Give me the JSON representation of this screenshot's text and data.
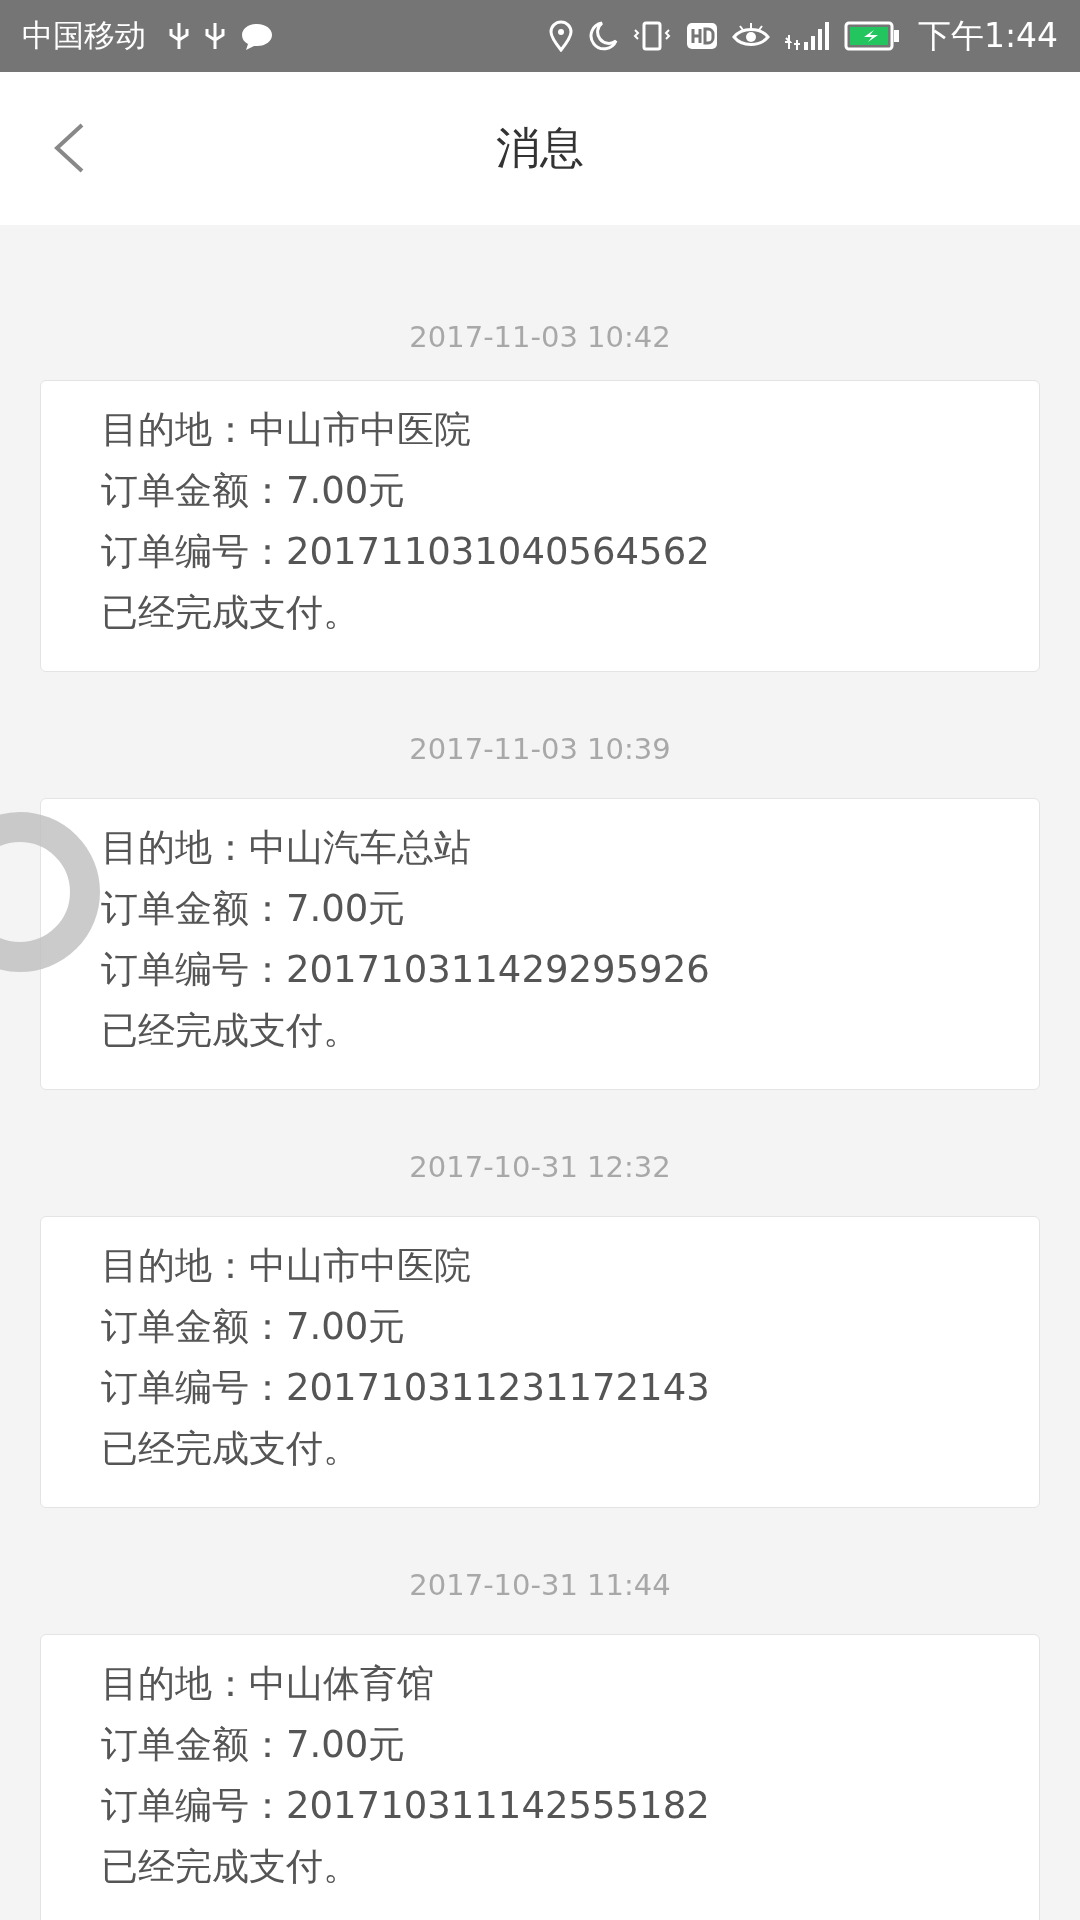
{
  "status_bar": {
    "carrier": "中国移动",
    "time": "下午1:44"
  },
  "header": {
    "title": "消息"
  },
  "messages": [
    {
      "time": "2017-11-03 10:42",
      "lines": [
        "目的地：中山市中医院",
        "订单金额：7.00元",
        "订单编号：201711031040564562",
        "已经完成支付。"
      ]
    },
    {
      "time": "2017-11-03 10:39",
      "lines": [
        "目的地：中山汽车总站",
        "订单金额：7.00元",
        "订单编号：201710311429295926",
        "已经完成支付。"
      ]
    },
    {
      "time": "2017-10-31 12:32",
      "lines": [
        "目的地：中山市中医院",
        "订单金额：7.00元",
        "订单编号：201710311231172143",
        "已经完成支付。"
      ]
    },
    {
      "time": "2017-10-31 11:44",
      "lines": [
        "目的地：中山体育馆",
        "订单金额：7.00元",
        "订单编号：201710311142555182",
        "已经完成支付。"
      ]
    }
  ]
}
